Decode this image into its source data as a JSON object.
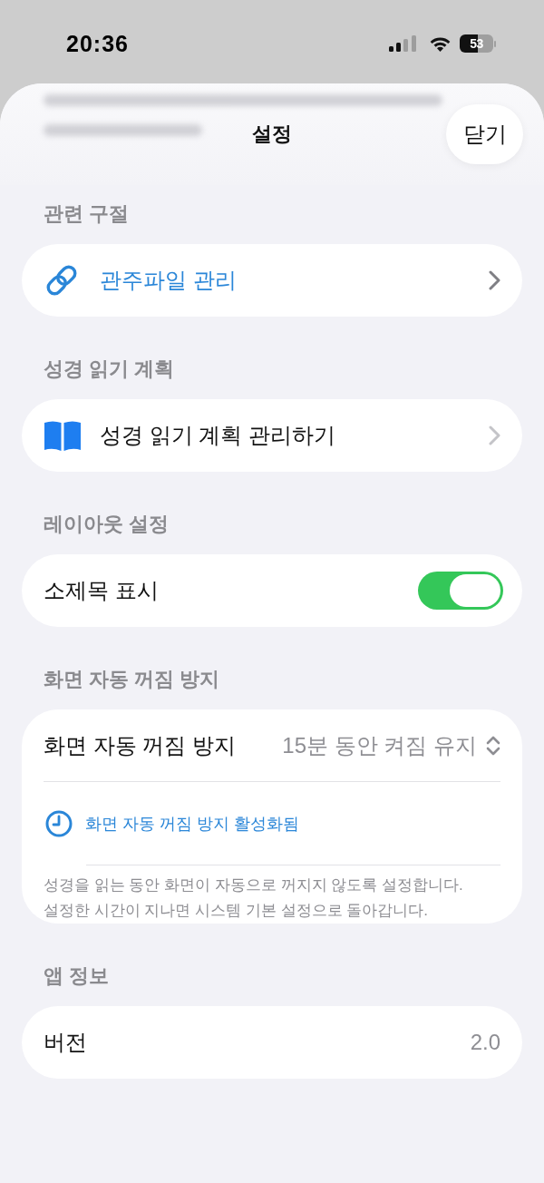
{
  "status_bar": {
    "time": "20:36",
    "battery": "53"
  },
  "sheet": {
    "title": "설정",
    "close_button": "닫기"
  },
  "sections": [
    {
      "header": "관련 구절",
      "rows": [
        {
          "kind": "link",
          "label": "관주파일 관리"
        }
      ]
    },
    {
      "header": "성경 읽기 계획",
      "rows": [
        {
          "kind": "navigation",
          "label": "성경 읽기 계획 관리하기"
        }
      ]
    },
    {
      "header": "레이아웃 설정",
      "rows": [
        {
          "kind": "toggle",
          "label": "소제목 표시",
          "on": true
        }
      ]
    },
    {
      "header": "화면 자동 꺼짐 방지",
      "rows": [
        {
          "kind": "picker",
          "label": "화면 자동 꺼짐 방지",
          "value": "15분 동안 켜짐 유지"
        },
        {
          "kind": "status",
          "label": "화면 자동 꺼짐 방지 활성화됨"
        },
        {
          "kind": "footnote",
          "text": "성경을 읽는 동안 화면이 자동으로 꺼지지 않도록 설정합니다.\n설정한 시간이 지나면 시스템 기본 설정으로 돌아갑니다."
        }
      ]
    },
    {
      "header": "앱 정보",
      "rows": [
        {
          "kind": "value",
          "label": "버전",
          "value": "2.0"
        }
      ]
    }
  ]
}
